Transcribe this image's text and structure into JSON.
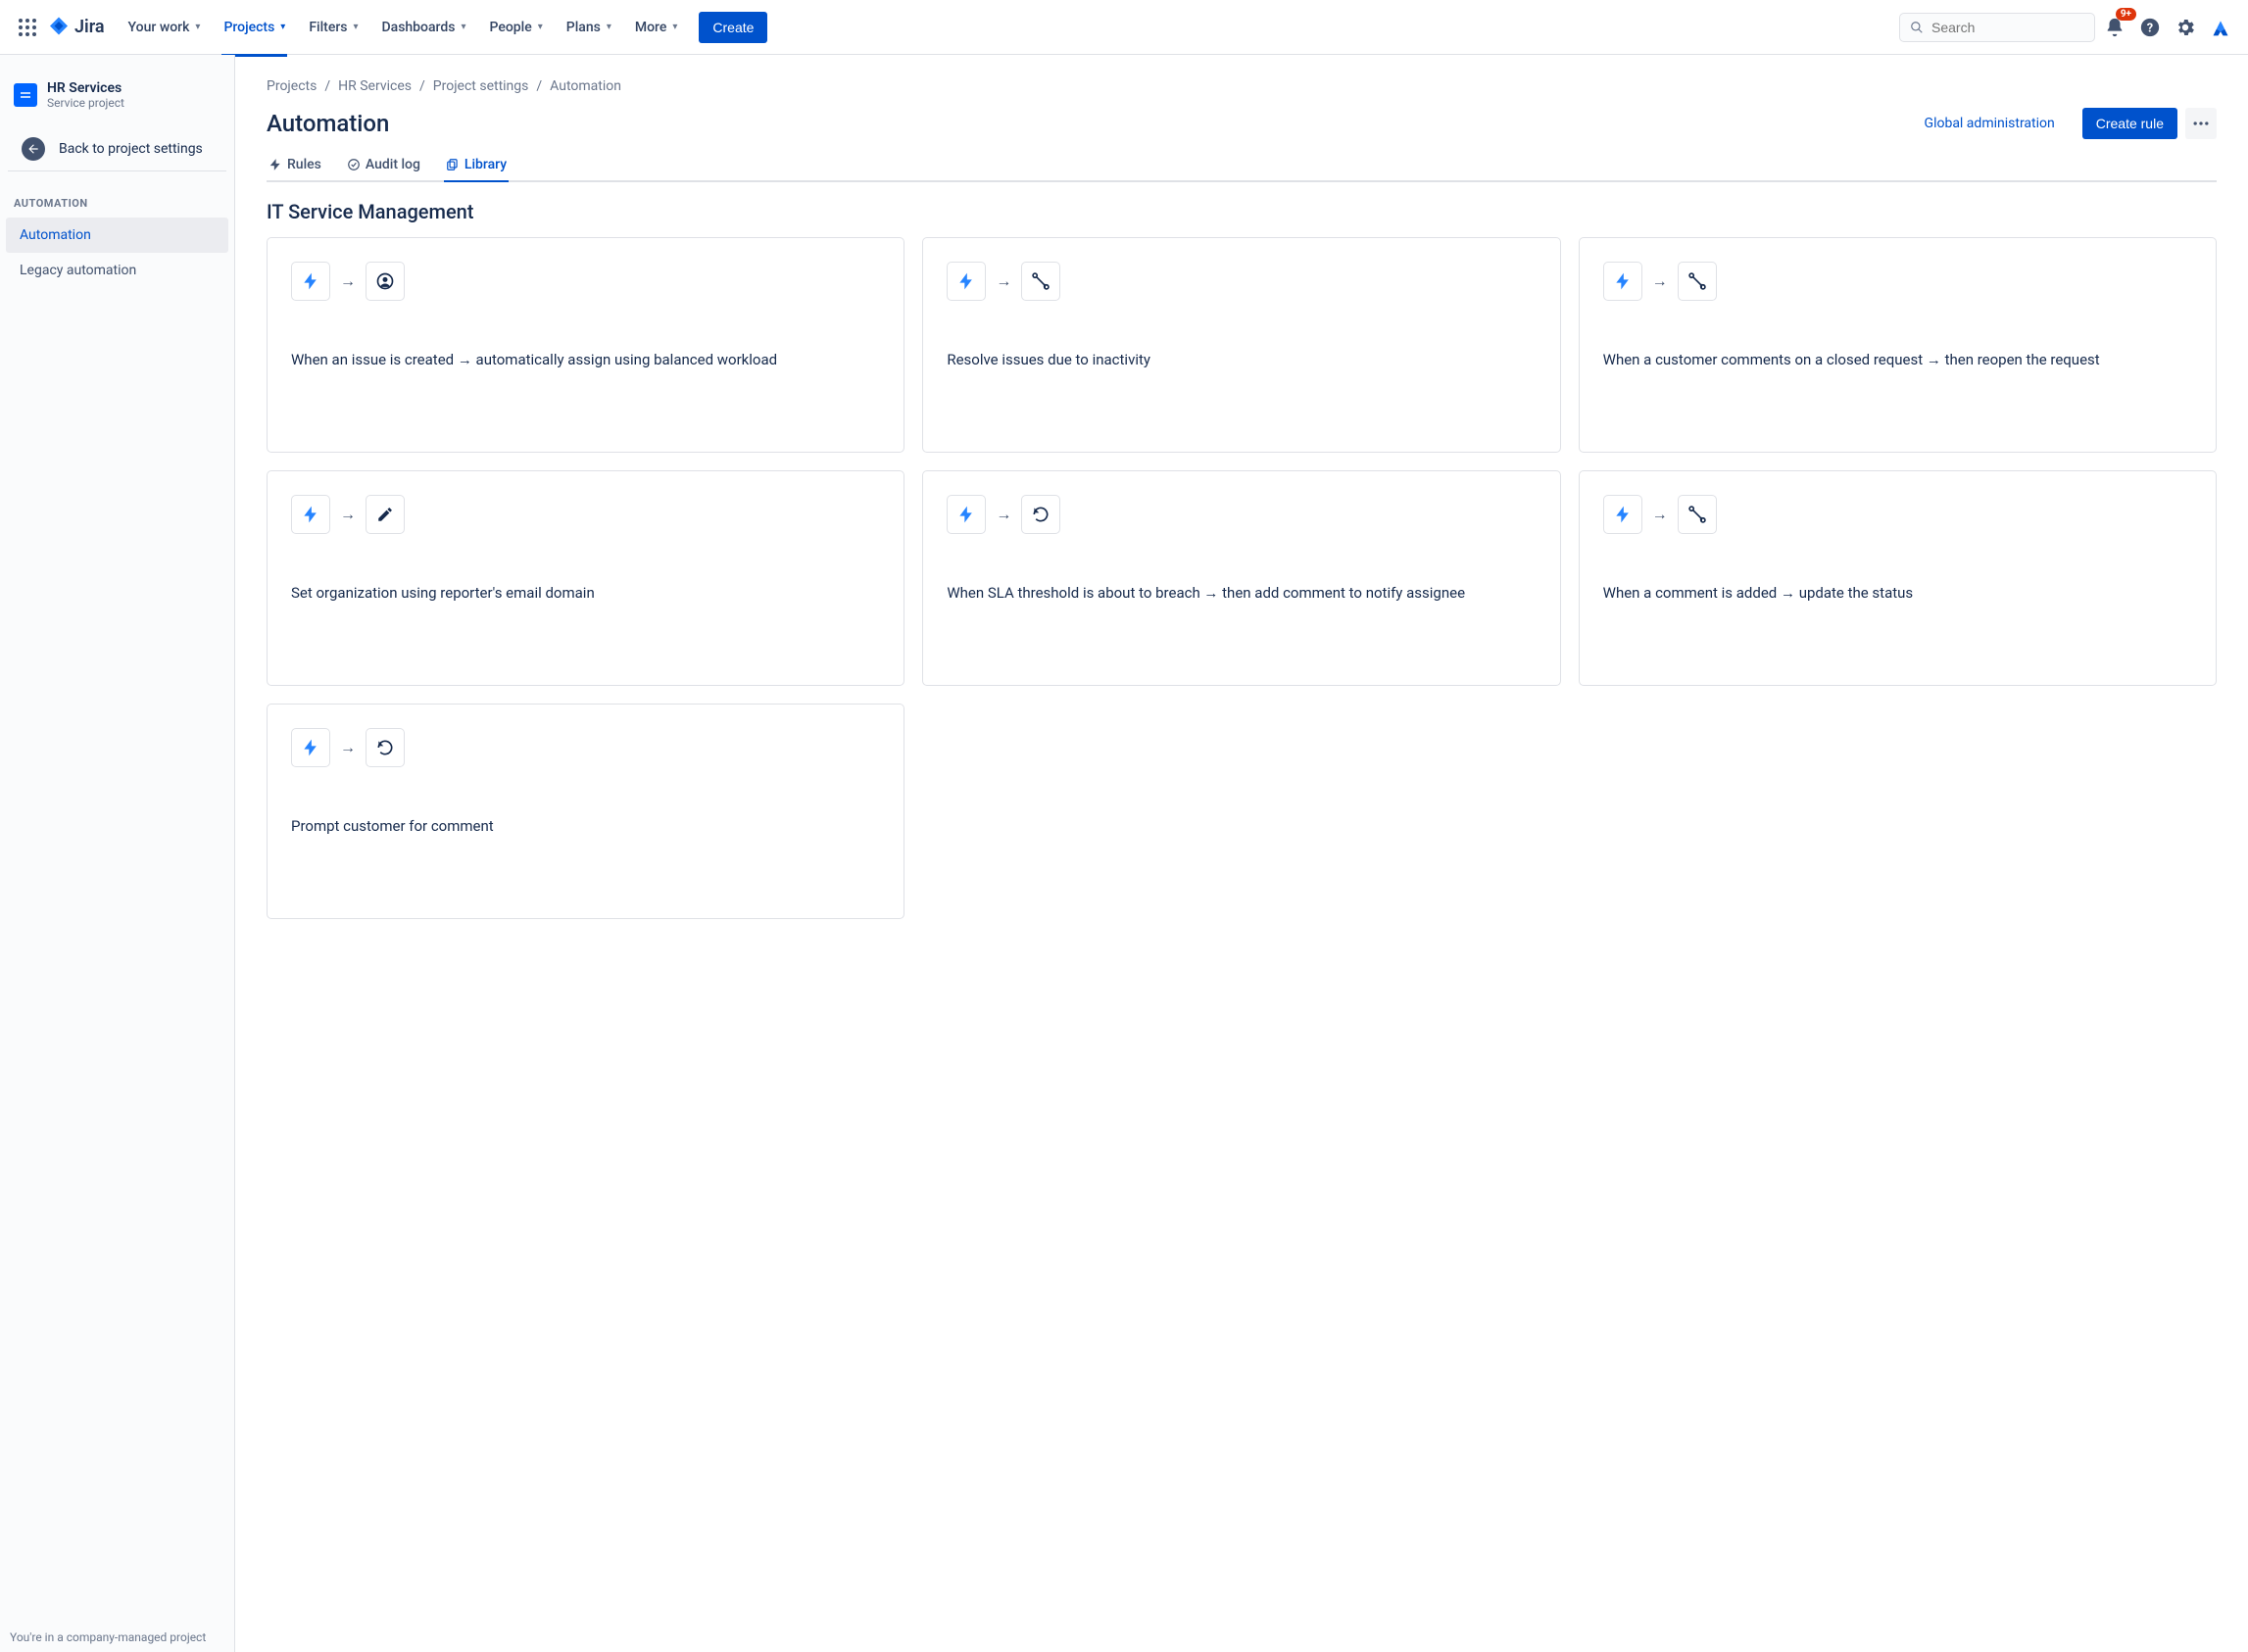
{
  "topnav": {
    "logo_text": "Jira",
    "items": [
      "Your work",
      "Projects",
      "Filters",
      "Dashboards",
      "People",
      "Plans",
      "More"
    ],
    "active_index": 1,
    "create_label": "Create",
    "search_placeholder": "Search",
    "notification_badge": "9+"
  },
  "sidebar": {
    "project_name": "HR Services",
    "project_type": "Service project",
    "back_label": "Back to project settings",
    "section_heading": "AUTOMATION",
    "items": [
      "Automation",
      "Legacy automation"
    ],
    "selected_index": 0,
    "footer": "You're in a company-managed project"
  },
  "breadcrumbs": [
    "Projects",
    "HR Services",
    "Project settings",
    "Automation"
  ],
  "page": {
    "title": "Automation",
    "global_admin_label": "Global administration",
    "create_rule_label": "Create rule"
  },
  "tabs": {
    "items": [
      "Rules",
      "Audit log",
      "Library"
    ],
    "active_index": 2
  },
  "library": {
    "section_title": "IT Service Management",
    "cards": [
      {
        "action_icon": "assignee",
        "text": "When an issue is created → automatically assign using balanced workload"
      },
      {
        "action_icon": "transition",
        "text": "Resolve issues due to inactivity"
      },
      {
        "action_icon": "transition",
        "text": "When a customer comments on a closed request → then reopen the request"
      },
      {
        "action_icon": "edit",
        "text": "Set organization using reporter's email domain"
      },
      {
        "action_icon": "refresh",
        "text": "When SLA threshold is about to breach → then add comment to notify assignee"
      },
      {
        "action_icon": "transition",
        "text": "When a comment is added → update the status"
      },
      {
        "action_icon": "refresh",
        "text": "Prompt customer for comment"
      }
    ]
  }
}
